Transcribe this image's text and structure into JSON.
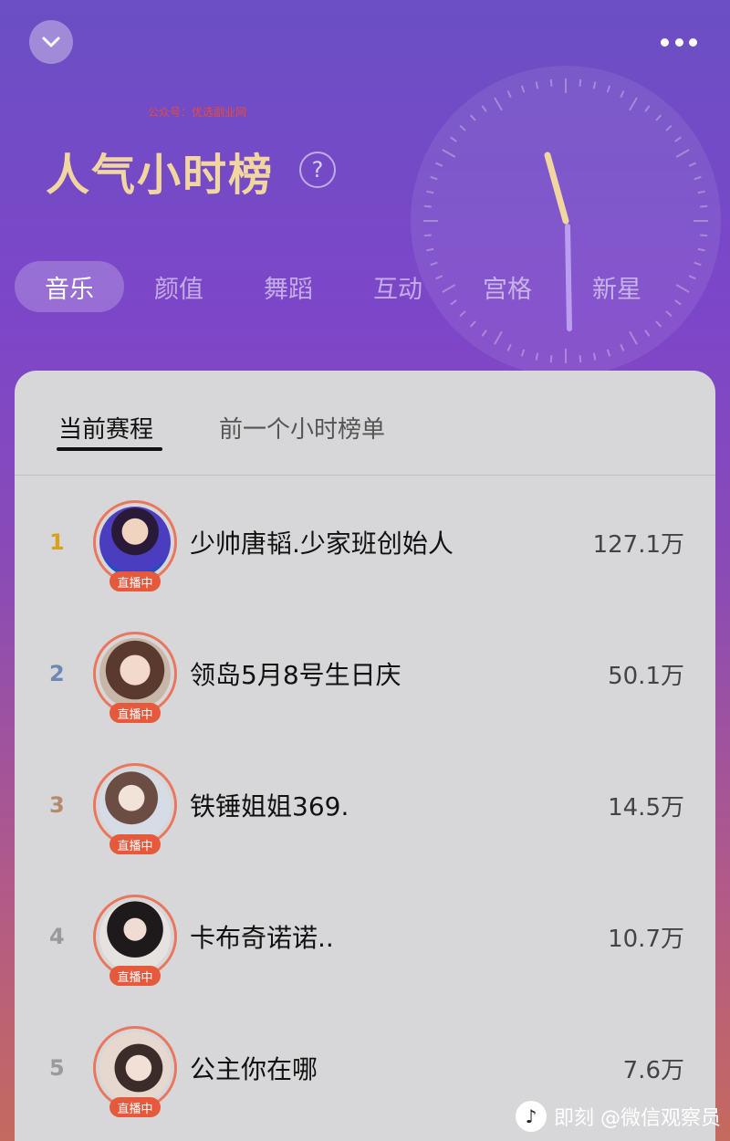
{
  "header": {
    "watermark": "公众号：优选副业网",
    "title": "人气小时榜",
    "help_symbol": "?",
    "collapse_icon": "chevron-down-icon",
    "more_icon": "more-dots-icon"
  },
  "category_tabs": [
    {
      "label": "音乐",
      "active": true
    },
    {
      "label": "颜值",
      "active": false
    },
    {
      "label": "舞蹈",
      "active": false
    },
    {
      "label": "互动",
      "active": false
    },
    {
      "label": "宫格",
      "active": false
    },
    {
      "label": "新星",
      "active": false
    }
  ],
  "sub_tabs": [
    {
      "label": "当前赛程",
      "active": true
    },
    {
      "label": "前一个小时榜单",
      "active": false
    }
  ],
  "ranking": [
    {
      "rank": "1",
      "name": "少帅唐韬.少家班创始人",
      "score": "127.1万",
      "live": "直播中",
      "rank_color": "#d9a21b"
    },
    {
      "rank": "2",
      "name": "领岛5月8号生日庆",
      "score": "50.1万",
      "live": "直播中",
      "rank_color": "#6f88b3"
    },
    {
      "rank": "3",
      "name": "铁锤姐姐369.",
      "score": "14.5万",
      "live": "直播中",
      "rank_color": "#b78a6b"
    },
    {
      "rank": "4",
      "name": "卡布奇诺诺..",
      "score": "10.7万",
      "live": "直播中",
      "rank_color": "#9a9a9a"
    },
    {
      "rank": "5",
      "name": "公主你在哪",
      "score": "7.6万",
      "live": "直播中",
      "rank_color": "#9a9a9a"
    }
  ],
  "footer": {
    "logo_symbol": "♪",
    "text": "即刻 @微信观察员"
  },
  "colors": {
    "title": "#f1d6a0",
    "live_badge": "#e55a3c",
    "avatar_ring": "#e9775e"
  }
}
